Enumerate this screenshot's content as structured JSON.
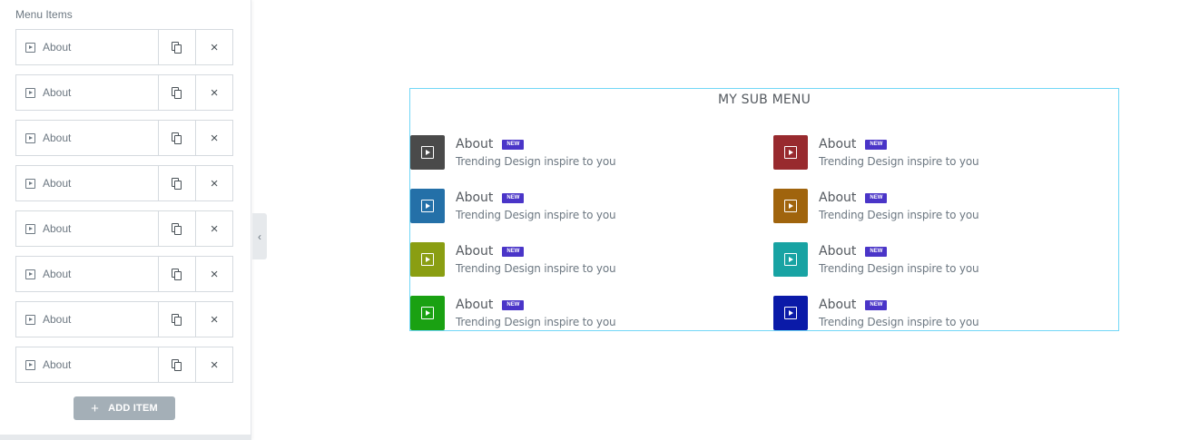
{
  "editor": {
    "section_label": "Menu Items",
    "items": [
      {
        "label": "About"
      },
      {
        "label": "About"
      },
      {
        "label": "About"
      },
      {
        "label": "About"
      },
      {
        "label": "About"
      },
      {
        "label": "About"
      },
      {
        "label": "About"
      },
      {
        "label": "About"
      }
    ],
    "add_button_label": "ADD ITEM",
    "add_icon": "+",
    "collapse_icon": "‹",
    "close_icon": "×"
  },
  "preview": {
    "title": "MY SUB MENU",
    "items": [
      {
        "title": "About",
        "badge": "NEW",
        "subtitle": "Trending Design inspire to you",
        "icon_color": "#4a4a4a"
      },
      {
        "title": "About",
        "badge": "NEW",
        "subtitle": "Trending Design inspire to you",
        "icon_color": "#982a2e"
      },
      {
        "title": "About",
        "badge": "NEW",
        "subtitle": "Trending Design inspire to you",
        "icon_color": "#2470a8"
      },
      {
        "title": "About",
        "badge": "NEW",
        "subtitle": "Trending Design inspire to you",
        "icon_color": "#a0640d"
      },
      {
        "title": "About",
        "badge": "NEW",
        "subtitle": "Trending Design inspire to you",
        "icon_color": "#8a9e12"
      },
      {
        "title": "About",
        "badge": "NEW",
        "subtitle": "Trending Design inspire to you",
        "icon_color": "#18a3a3"
      },
      {
        "title": "About",
        "badge": "NEW",
        "subtitle": "Trending Design inspire to you",
        "icon_color": "#1aa112"
      },
      {
        "title": "About",
        "badge": "NEW",
        "subtitle": "Trending Design inspire to you",
        "icon_color": "#0a1aa8"
      }
    ]
  }
}
